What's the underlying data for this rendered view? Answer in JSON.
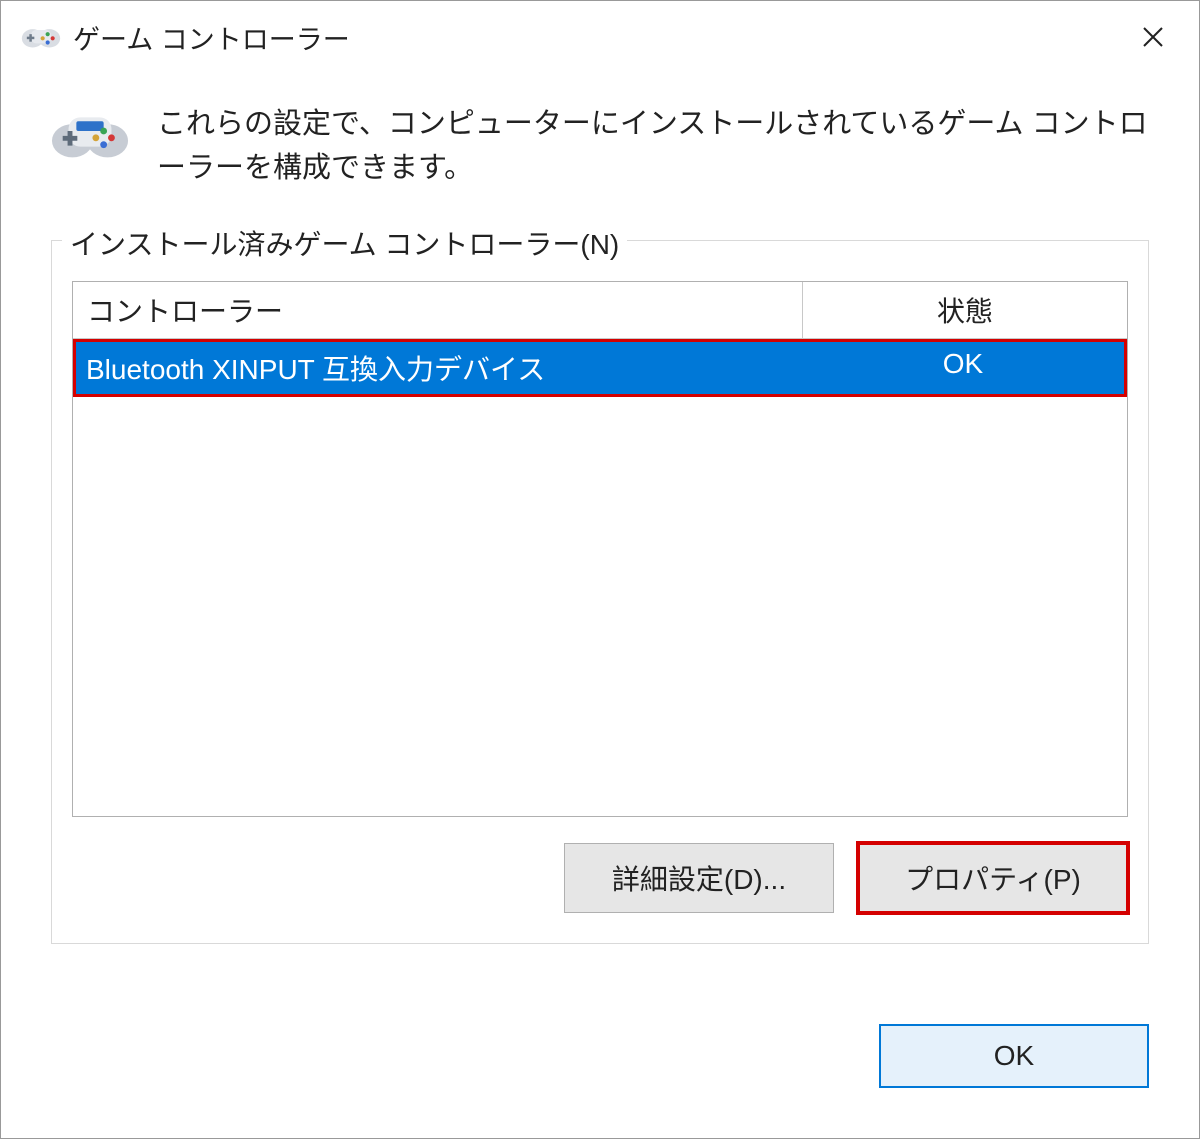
{
  "window": {
    "title": "ゲーム コントローラー"
  },
  "intro": {
    "text": "これらの設定で、コンピューターにインストールされているゲーム コントローラーを構成できます。"
  },
  "group": {
    "label": "インストール済みゲーム コントローラー(N)",
    "columns": {
      "controller": "コントローラー",
      "status": "状態"
    },
    "rows": [
      {
        "controller": "Bluetooth XINPUT 互換入力デバイス",
        "status": "OK"
      }
    ]
  },
  "buttons": {
    "advanced": "詳細設定(D)...",
    "properties": "プロパティ(P)",
    "ok": "OK"
  }
}
